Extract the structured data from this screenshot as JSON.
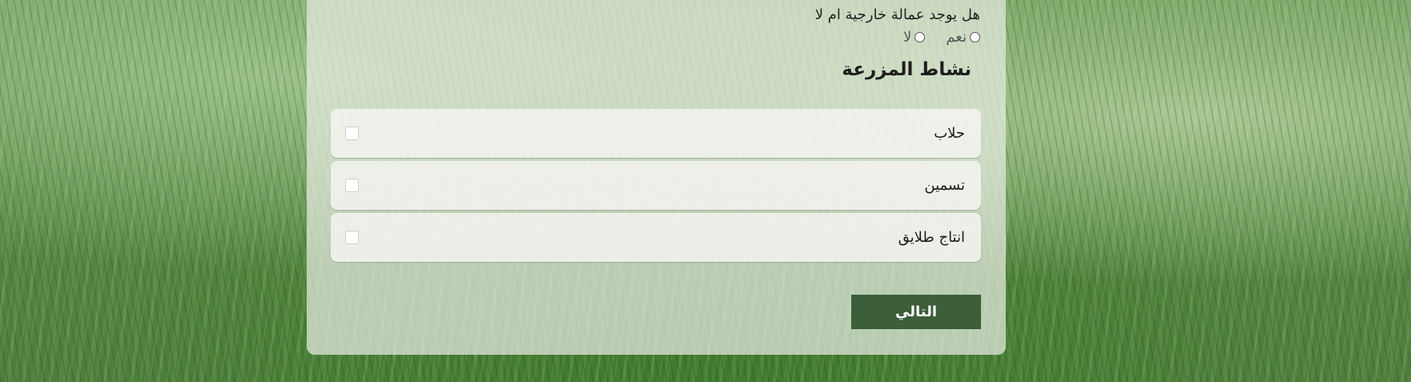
{
  "form": {
    "question": "هل يوجد عمالة خارجية ام لا",
    "radio_options": {
      "yes": "نعم",
      "no": "لا"
    },
    "section_title": "نشاط المزرعة",
    "activities": [
      {
        "label": "حلاب"
      },
      {
        "label": "تسمين"
      },
      {
        "label": "انتاج طلايق"
      }
    ],
    "next_label": "التالي"
  },
  "colors": {
    "button": "#3c5e39",
    "card": "#e8ece2"
  }
}
